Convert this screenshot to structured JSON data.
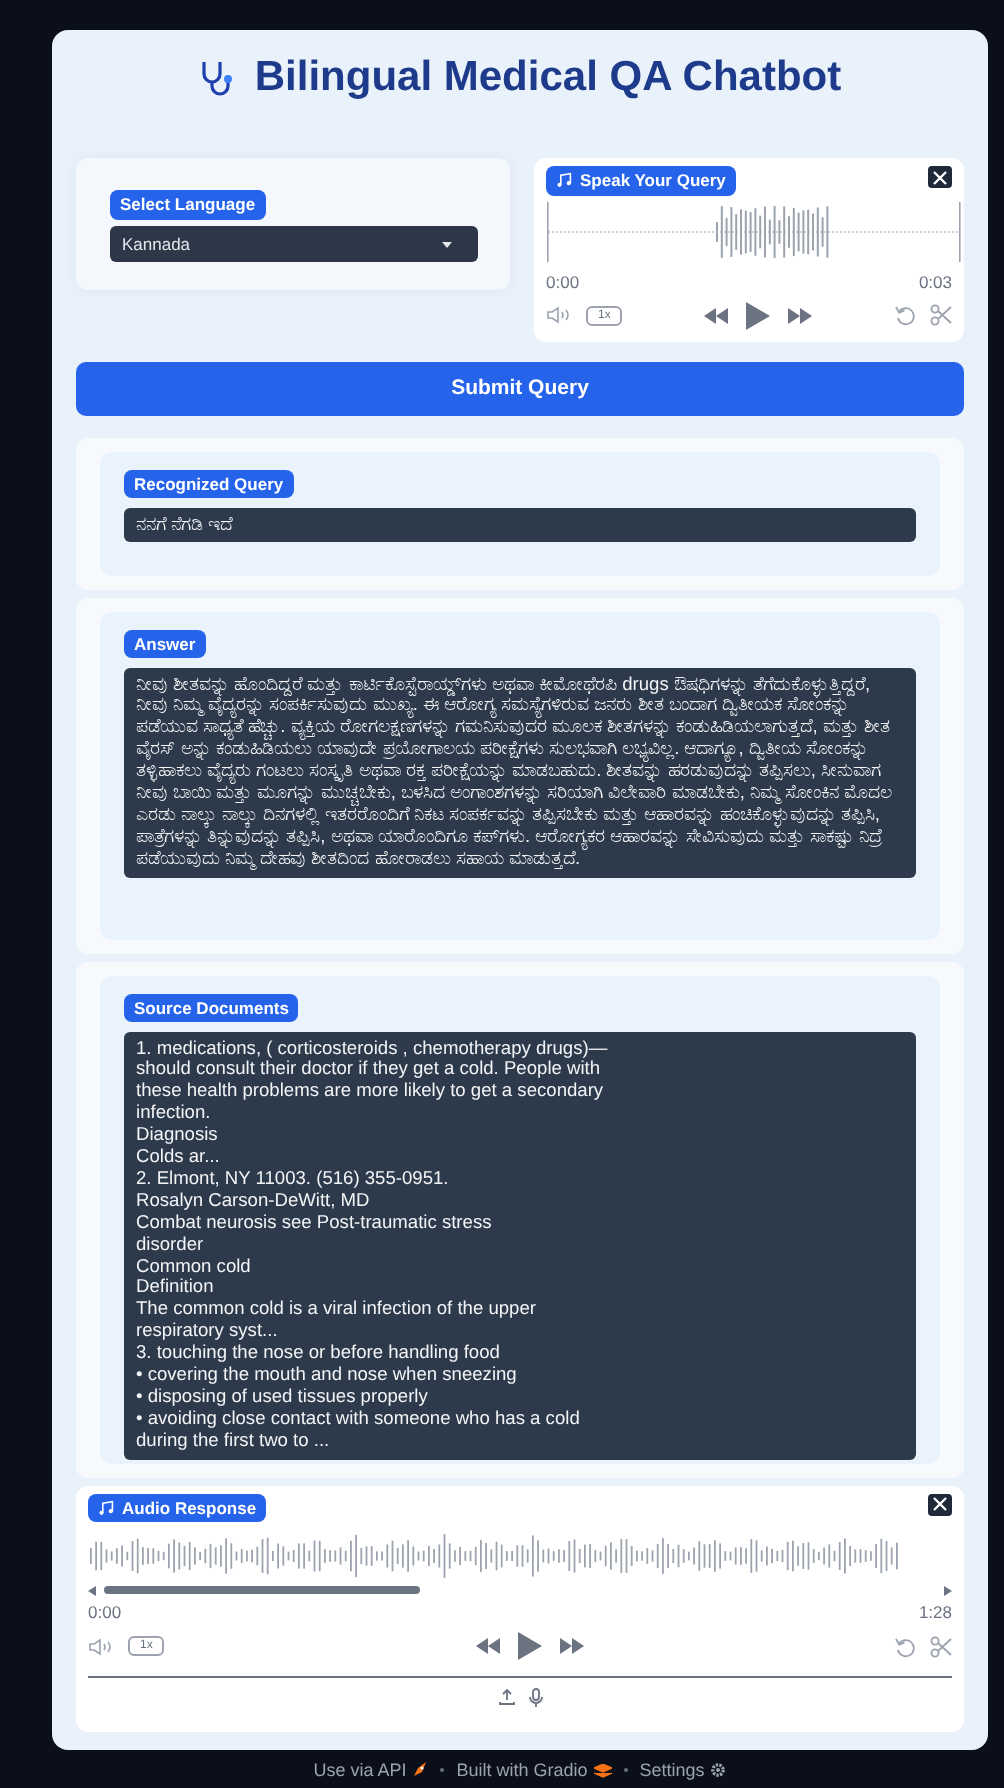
{
  "title": "Bilingual Medical QA Chatbot",
  "language": {
    "label": "Select Language",
    "value": "Kannada"
  },
  "query_audio": {
    "label": "Speak Your Query",
    "time_start": "0:00",
    "time_end": "0:03",
    "speed": "1x"
  },
  "submit_button": "Submit Query",
  "recognized_query": {
    "label": "Recognized Query",
    "value": "ನನಗೆ ನೆಗಡಿ ಇದೆ"
  },
  "answer": {
    "label": "Answer",
    "text": "ನೀವು ಶೀತವನ್ನು ಹೊಂದಿದ್ದರೆ ಮತ್ತು ಕಾರ್ಟಿಕೊಸ್ಟೆರಾಯ್ಡ್‌ಗಳು ಅಥವಾ ಕೀಮೋಥೆರಪಿ drugs ಔಷಧಿಗಳನ್ನು ತೆಗೆದುಕೊಳ್ಳುತ್ತಿದ್ದರೆ, ನೀವು ನಿಮ್ಮ ವೈದ್ಯರನ್ನು ಸಂಪರ್ಕಿಸುವುದು ಮುಖ್ಯ. ಈ ಆರೋಗ್ಯ ಸಮಸ್ಯೆಗಳಿರುವ ಜನರು ಶೀತ ಬಂದಾಗ ದ್ವಿತೀಯಕ ಸೋಂಕನ್ನು ಪಡೆಯುವ ಸಾಧ್ಯತೆ ಹೆಚ್ಚು. ವ್ಯಕ್ತಿಯ ರೋಗಲಕ್ಷಣಗಳನ್ನು ಗಮನಿಸುವುದರ ಮೂಲಕ ಶೀತಗಳನ್ನು ಕಂಡುಹಿಡಿಯಲಾಗುತ್ತದೆ, ಮತ್ತು ಶೀತ ವೈರಸ್ ಅನ್ನು ಕಂಡುಹಿಡಿಯಲು ಯಾವುದೇ ಪ್ರಯೋಗಾಲಯ ಪರೀಕ್ಷೆಗಳು ಸುಲಭವಾಗಿ ಲಭ್ಯವಿಲ್ಲ. ಆದಾಗ್ಯೂ, ದ್ವಿತೀಯ ಸೋಂಕನ್ನು ತಳ್ಳಿಹಾಕಲು ವೈದ್ಯರು ಗಂಟಲು ಸಂಸ್ಕೃತಿ ಅಥವಾ ರಕ್ತ ಪರೀಕ್ಷೆಯನ್ನು ಮಾಡಬಹುದು. ಶೀತವನ್ನು ಹರಡುವುದನ್ನು ತಪ್ಪಿಸಲು, ಸೀನುವಾಗ ನೀವು ಬಾಯಿ ಮತ್ತು ಮೂಗನ್ನು ಮುಚ್ಚಬೇಕು, ಬಳಸಿದ ಅಂಗಾಂಶಗಳನ್ನು ಸರಿಯಾಗಿ ವಿಲೇವಾರಿ ಮಾಡಬೇಕು, ನಿಮ್ಮ ಸೋಂಕಿನ ಮೊದಲ ಎರಡು ನಾಲ್ಕು ನಾಲ್ಕು ದಿನಗಳಲ್ಲಿ ಇತರರೊಂದಿಗೆ ನಿಕಟ ಸಂಪರ್ಕವನ್ನು ತಪ್ಪಿಸಬೇಕು ಮತ್ತು ಆಹಾರವನ್ನು ಹಂಚಿಕೊಳ್ಳುವುದನ್ನು ತಪ್ಪಿಸಿ, ಪಾತ್ರೆಗಳನ್ನು ತಿನ್ನುವುದನ್ನು ತಪ್ಪಿಸಿ, ಅಥವಾ ಯಾರೊಂದಿಗೂ ಕಪ್‌ಗಳು. ಆರೋಗ್ಯಕರ ಆಹಾರವನ್ನು ಸೇವಿಸುವುದು ಮತ್ತು ಸಾಕಷ್ಟು ನಿದ್ರೆ ಪಡೆಯುವುದು ನಿಮ್ಮ ದೇಹವು ಶೀತದಿಂದ ಹೋರಾಡಲು ಸಹಾಯ ಮಾಡುತ್ತದೆ."
  },
  "source_documents": {
    "label": "Source Documents",
    "text": "1. medications, ( corticosteroids , chemotherapy drugs)—\nshould consult their doctor if they get a cold. People with\nthese health problems are more likely to get a secondary\ninfection.\nDiagnosis\nColds ar...\n2. Elmont, NY 11003. (516) 355-0951.\nRosalyn Carson-DeWitt, MD\nCombat neurosis see Post-traumatic stress\ndisorder\nCommon cold\nDefinition\nThe common cold is a viral infection of the upper\nrespiratory syst...\n3. touching the nose or before handling food\n• covering the mouth and nose when sneezing\n• disposing of used tissues properly\n• avoiding close contact with someone who has a cold\nduring the first two to ..."
  },
  "audio_response": {
    "label": "Audio Response",
    "time_start": "0:00",
    "time_end": "1:28",
    "speed": "1x"
  },
  "footer": [
    "Use via API",
    "Built with Gradio",
    "Settings"
  ]
}
